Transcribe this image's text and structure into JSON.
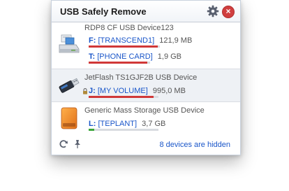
{
  "window": {
    "title": "USB Safely Remove",
    "accent": "#1a56c9"
  },
  "devices": [
    {
      "name": "RDP8 CF USB Device123",
      "icon": "card-reader-icon",
      "volumes": [
        {
          "letter": "F:",
          "label": "[TRANSCEND1]",
          "size": "121,9 MB",
          "usage": 0.97,
          "bar_color": "#d03838"
        },
        {
          "letter": "T:",
          "label": "[PHONE CARD]",
          "size": "1,9 GB",
          "usage": 0.95,
          "bar_color": "#d03838"
        }
      ]
    },
    {
      "name": "JetFlash TS1GJF2B USB Device",
      "icon": "usb-flash-drive-icon",
      "locked": true,
      "volumes": [
        {
          "letter": "J:",
          "label": "[MY VOLUME]",
          "size": "995,0 MB",
          "usage": 0.93,
          "bar_color": "#d03838"
        }
      ]
    },
    {
      "name": "Generic Mass Storage USB Device",
      "icon": "external-hdd-icon",
      "volumes": [
        {
          "letter": "L:",
          "label": "[TEPLANT]",
          "size": "3,7 GB",
          "usage": 0.08,
          "bar_color": "#3aa63a"
        }
      ]
    }
  ],
  "footer": {
    "hidden_devices": "8 devices are hidden"
  }
}
